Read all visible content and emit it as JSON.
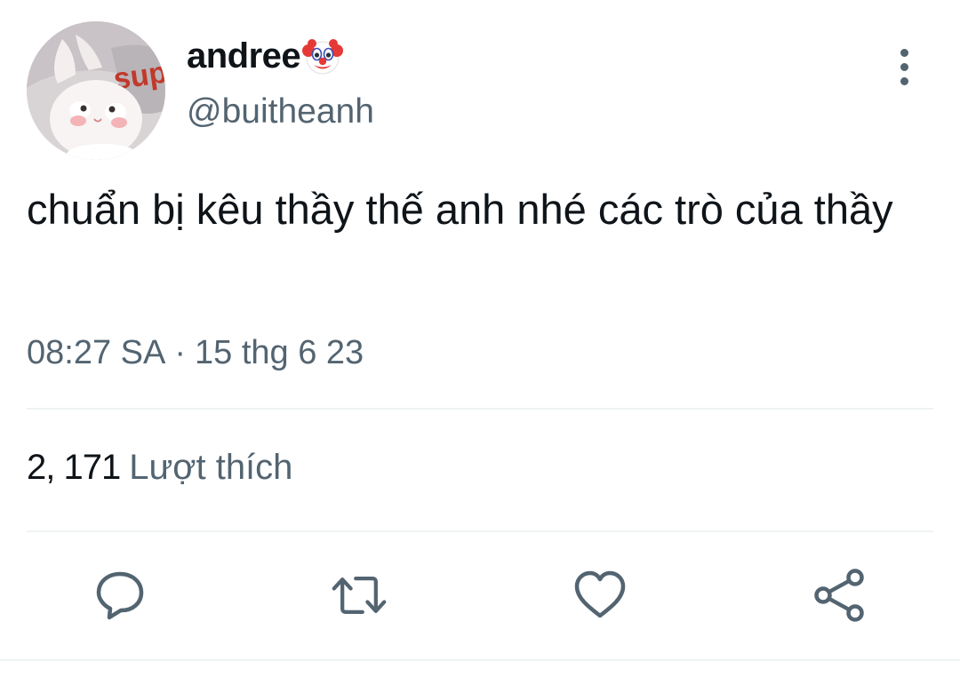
{
  "tweet": {
    "display_name": "andree",
    "name_emoji_icon": "clown-face-icon",
    "handle": "@buitheanh",
    "text": "chuẩn bị kêu thầy thế anh nhé các trò của thầy",
    "time": "08:27 SA",
    "separator": "·",
    "date": "15 thg 6 23",
    "likes_count": "2, 171",
    "likes_label": "Lượt thích",
    "avatar_text": "sup"
  },
  "actions": [
    {
      "name": "reply",
      "icon": "comment-icon"
    },
    {
      "name": "retweet",
      "icon": "retweet-icon"
    },
    {
      "name": "like",
      "icon": "heart-icon"
    },
    {
      "name": "share",
      "icon": "share-icon"
    }
  ],
  "colors": {
    "primary_text": "#0f1419",
    "secondary_text": "#536471",
    "divider": "#eff3f4"
  }
}
